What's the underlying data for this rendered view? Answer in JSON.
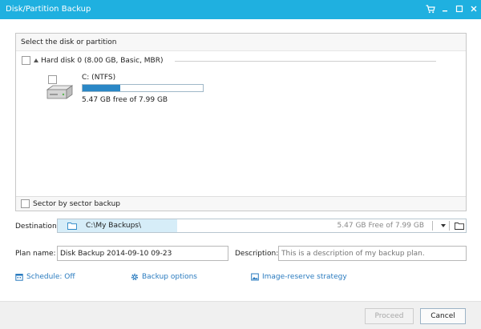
{
  "window": {
    "title": "Disk/Partition Backup",
    "accent_color": "#1fb0e0",
    "controls": [
      "cart-icon",
      "minimize-icon",
      "maximize-icon",
      "close-icon"
    ]
  },
  "source": {
    "header": "Select the disk or partition",
    "disk": {
      "label": "Hard disk 0 (8.00 GB, Basic, MBR)",
      "checked": false
    },
    "partition": {
      "name": "C: (NTFS)",
      "free_text": "5.47 GB free of 7.99 GB",
      "used_fraction": 0.315,
      "checked": false
    },
    "sector_backup_label": "Sector by sector backup"
  },
  "destination": {
    "label": "Destination:",
    "path": "C:\\My Backups\\",
    "free": "5.47 GB Free of 7.99 GB"
  },
  "plan": {
    "name_label": "Plan name:",
    "name_value": "Disk Backup 2014-09-10 09-23",
    "description_label": "Description:",
    "description_placeholder": "This is a description of my backup plan."
  },
  "options": {
    "schedule": "Schedule: Off",
    "backup_options": "Backup options",
    "image_reserve": "Image-reserve strategy"
  },
  "buttons": {
    "proceed": "Proceed",
    "cancel": "Cancel"
  }
}
